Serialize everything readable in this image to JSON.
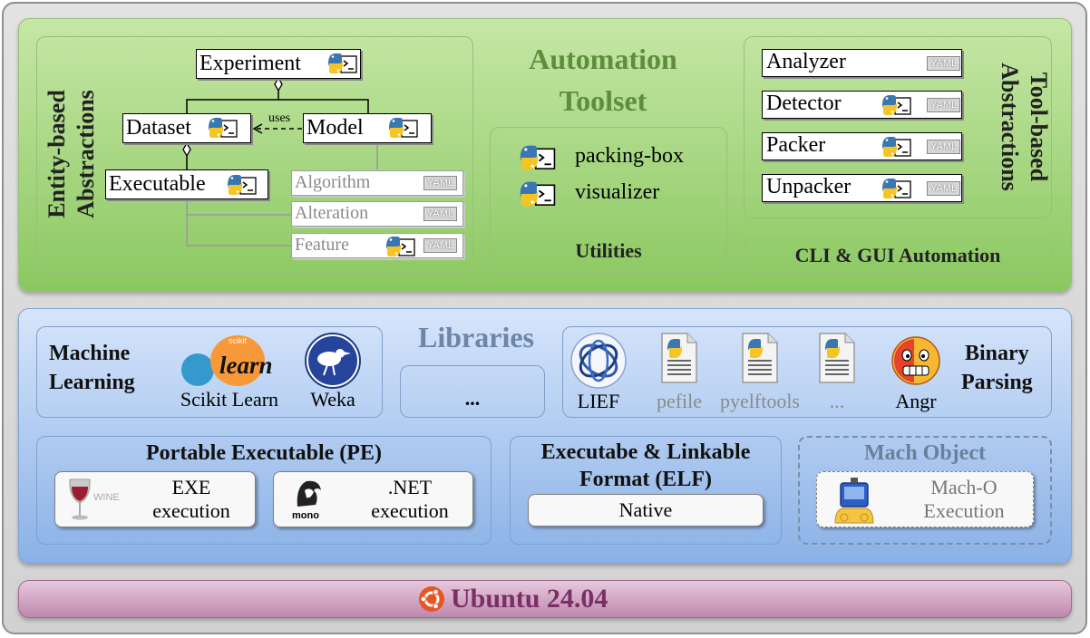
{
  "automation": {
    "title_line1": "Automation",
    "title_line2": "Toolset",
    "entity_label_line1": "Entity-based",
    "entity_label_line2": "Abstractions",
    "tool_label_line1": "Tool-based",
    "tool_label_line2": "Abstractions",
    "entities": {
      "experiment": "Experiment",
      "dataset": "Dataset",
      "model": "Model",
      "executable": "Executable",
      "uses": "uses",
      "algorithm": "Algorithm",
      "alteration": "Alteration",
      "feature": "Feature"
    },
    "utilities": {
      "label": "Utilities",
      "items": [
        "packing-box",
        "visualizer"
      ]
    },
    "tools": [
      "Analyzer",
      "Detector",
      "Packer",
      "Unpacker"
    ],
    "cli_gui": "CLI & GUI Automation",
    "yaml": "YAML"
  },
  "libraries": {
    "title": "Libraries",
    "ml": {
      "label_line1": "Machine",
      "label_line2": "Learning",
      "sklearn_label": "Scikit Learn",
      "sklearn_logo_word": "learn",
      "sklearn_logo_small": "scikit",
      "weka_label": "Weka"
    },
    "more": "...",
    "binary": {
      "label_line1": "Binary",
      "label_line2": "Parsing",
      "items": [
        "LIEF",
        "pefile",
        "pyelftools",
        "...",
        "Angr"
      ]
    },
    "pe": {
      "title": "Portable Executable (PE)",
      "exe_line1": "EXE",
      "exe_line2": "execution",
      "wine_logo": "WINE",
      "net_line1": ".NET",
      "net_line2": "execution",
      "mono_logo": "mono"
    },
    "elf": {
      "title_line1": "Executabe & Linkable",
      "title_line2": "Format (ELF)",
      "native": "Native"
    },
    "mach": {
      "title": "Mach Object",
      "exec_line1": "Mach-O",
      "exec_line2": "Execution"
    }
  },
  "os": {
    "label": "Ubuntu 24.04"
  },
  "colors": {
    "green_title": "#5f8d3c",
    "blue_title": "#6c86a8",
    "python_blue": "#3a76b0",
    "python_yellow": "#f5c526",
    "ubuntu_orange": "#e95420"
  }
}
